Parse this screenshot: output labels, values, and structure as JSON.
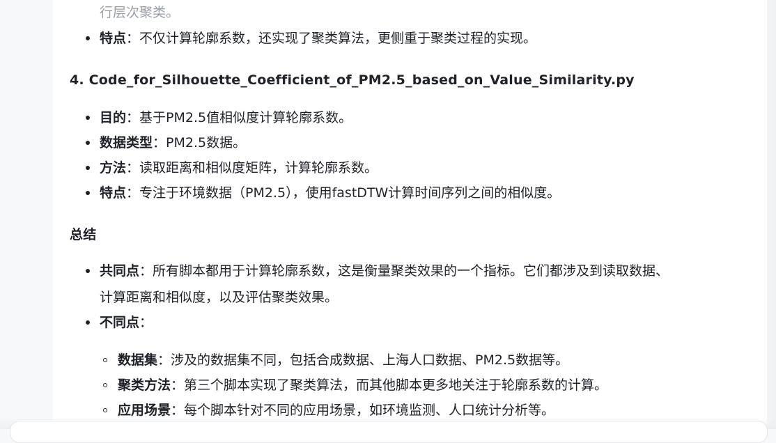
{
  "top_fragment": "行层次聚类。",
  "script3": {
    "feature_label": "特点",
    "feature_text": "：不仅计算轮廓系数，还实现了聚类算法，更侧重于聚类过程的实现。"
  },
  "script4": {
    "heading": "4. Code_for_Silhouette_Coefficient_of_PM2.5_based_on_Value_Similarity.py",
    "items": [
      {
        "label": "目的",
        "text": "：基于PM2.5值相似度计算轮廓系数。"
      },
      {
        "label": "数据类型",
        "text": "：PM2.5数据。"
      },
      {
        "label": "方法",
        "text": "：读取距离和相似度矩阵，计算轮廓系数。"
      },
      {
        "label": "特点",
        "text": "：专注于环境数据（PM2.5），使用fastDTW计算时间序列之间的相似度。"
      }
    ]
  },
  "summary": {
    "heading": "总结",
    "common_label": "共同点",
    "common_text_line1": "：所有脚本都用于计算轮廓系数，这是衡量聚类效果的一个指标。它们都涉及到读取数据、",
    "common_text_line2": "计算距离和相似度，以及评估聚类效果。",
    "diff_label": "不同点",
    "diff_text": "：",
    "sub_items": [
      {
        "label": "数据集",
        "text": "：涉及的数据集不同，包括合成数据、上海人口数据、PM2.5数据等。"
      },
      {
        "label": "聚类方法",
        "text": "：第三个脚本实现了聚类算法，而其他脚本更多地关注于轮廓系数的计算。"
      },
      {
        "label": "应用场景",
        "text": "：每个脚本针对不同的应用场景，如环境监测、人口统计分析等。"
      }
    ]
  }
}
